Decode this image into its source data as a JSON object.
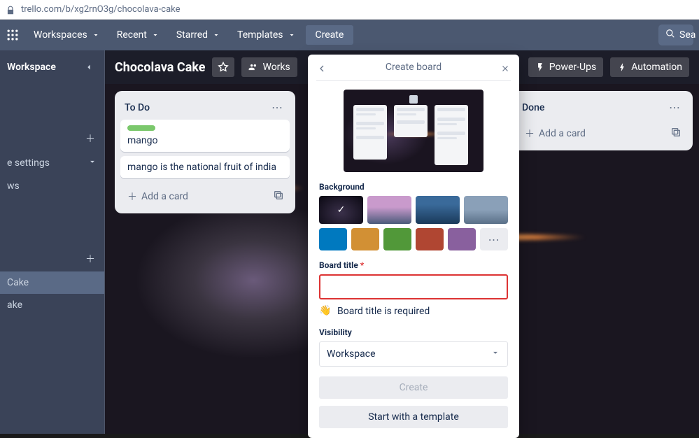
{
  "url": "trello.com/b/xg2rnO3g/chocolava-cake",
  "topnav": {
    "workspaces": "Workspaces",
    "recent": "Recent",
    "starred": "Starred",
    "templates": "Templates",
    "create": "Create",
    "search": "Sea"
  },
  "sidebar": {
    "workspace_label": "Workspace",
    "settings": "e settings",
    "ws": "ws",
    "cake_item": "Cake",
    "ake_item": "ake"
  },
  "board": {
    "title": "Chocolava Cake",
    "workspace_btn": "Works",
    "powerups": "Power-Ups",
    "automation": "Automation"
  },
  "lists": {
    "todo": {
      "title": "To Do",
      "card1": "mango",
      "card2": "mango is the national fruit of india",
      "add": "Add a card"
    },
    "done": {
      "title": "Done",
      "add": "Add a card"
    }
  },
  "popover": {
    "title": "Create board",
    "background_label": "Background",
    "board_title_label": "Board title",
    "required_hint": "Board title is required",
    "visibility_label": "Visibility",
    "visibility_value": "Workspace",
    "create_btn": "Create",
    "template_btn": "Start with a template",
    "title_value": "",
    "colors": {
      "c1": "#0079bf",
      "c2": "#d29034",
      "c3": "#519839",
      "c4": "#b04632",
      "c5": "#89609e"
    }
  }
}
